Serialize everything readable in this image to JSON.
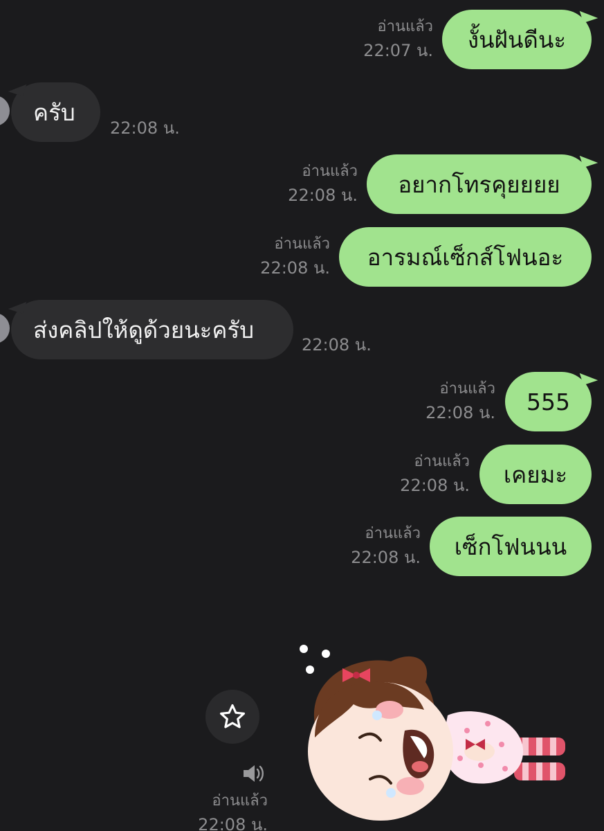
{
  "read_label": "อ่านแล้ว",
  "messages": [
    {
      "direction": "out",
      "text": "งั้นฝันดีนะ",
      "time": "22:07 น.",
      "status": "อ่านแล้ว"
    },
    {
      "direction": "in",
      "text": "ครับ",
      "time": "22:08 น."
    },
    {
      "direction": "out",
      "text": "อยากโทรคุยยยย",
      "time": "22:08 น.",
      "status": "อ่านแล้ว"
    },
    {
      "direction": "out",
      "text": "อารมณ์เซ็กส์โฟนอะ",
      "time": "22:08 น.",
      "status": "อ่านแล้ว"
    },
    {
      "direction": "in",
      "text": "ส่งคลิปให้ดูด้วยนะครับ",
      "time": "22:08 น."
    },
    {
      "direction": "out",
      "text": "555",
      "time": "22:08 น.",
      "status": "อ่านแล้ว"
    },
    {
      "direction": "out",
      "text": "เคยมะ",
      "time": "22:08 น.",
      "status": "อ่านแล้ว"
    },
    {
      "direction": "out",
      "text": "เซ็กโฟนนน",
      "time": "22:08 น.",
      "status": "อ่านแล้ว"
    }
  ],
  "sticker_message": {
    "status": "อ่านแล้ว",
    "time": "22:08 น.",
    "icons": [
      "star-icon",
      "speaker-icon"
    ]
  },
  "colors": {
    "background": "#1b1b1d",
    "outgoing_bubble": "#a1e38e",
    "incoming_bubble": "#2d2d2f",
    "meta_text": "#8d8d8f"
  }
}
